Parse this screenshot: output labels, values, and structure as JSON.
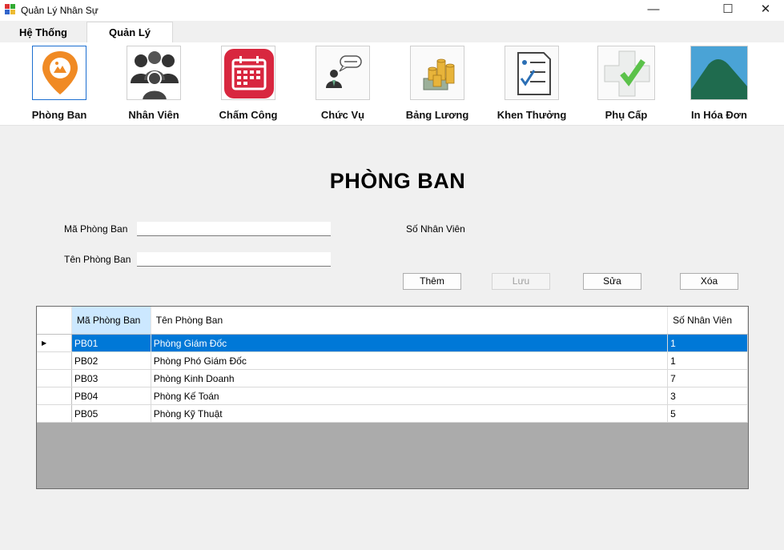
{
  "window": {
    "title": "Quản Lý Nhân Sự",
    "minimize": "—",
    "maximize": "☐",
    "close": "✕"
  },
  "tabs": [
    {
      "label": "Hệ Thống"
    },
    {
      "label": "Quản Lý"
    }
  ],
  "active_tab": "Quản Lý",
  "ribbon": [
    {
      "label": "Phòng Ban",
      "icon": "location-pin-icon"
    },
    {
      "label": "Nhân Viên",
      "icon": "people-icon"
    },
    {
      "label": "Chấm Công",
      "icon": "calendar-icon"
    },
    {
      "label": "Chức Vụ",
      "icon": "speaker-person-icon"
    },
    {
      "label": "Bảng Lương",
      "icon": "money-coins-icon"
    },
    {
      "label": "Khen Thưởng",
      "icon": "checklist-icon"
    },
    {
      "label": "Phụ Cấp",
      "icon": "medical-cross-icon"
    },
    {
      "label": "In Hóa Đơn",
      "icon": "mountain-icon"
    }
  ],
  "page": {
    "heading": "PHÒNG BAN"
  },
  "form": {
    "ma_phong_ban_label": "Mã Phòng Ban",
    "ma_phong_ban_value": "",
    "ten_phong_ban_label": "Tên Phòng Ban",
    "ten_phong_ban_value": "",
    "so_nhan_vien_label": "Số Nhân Viên"
  },
  "buttons": {
    "them": "Thêm",
    "luu": "Lưu",
    "sua": "Sửa",
    "xoa": "Xóa"
  },
  "table": {
    "columns": [
      "Mã Phòng Ban",
      "Tên Phòng Ban",
      "Số Nhân Viên"
    ],
    "row_marker": "▶",
    "rows": [
      [
        "PB01",
        "Phòng Giám Đốc",
        "1"
      ],
      [
        "PB02",
        "Phòng Phó Giám Đốc",
        "1"
      ],
      [
        "PB03",
        "Phòng Kinh Doanh",
        "7"
      ],
      [
        "PB04",
        "Phòng Kế Toán",
        "3"
      ],
      [
        "PB05",
        "Phòng Kỹ Thuật",
        "5"
      ]
    ],
    "selected_row": 0
  },
  "colors": {
    "selection": "#0078d7",
    "header_selected": "#cce8ff",
    "grid_background": "#ababab",
    "accent_orange": "#f08a24"
  }
}
